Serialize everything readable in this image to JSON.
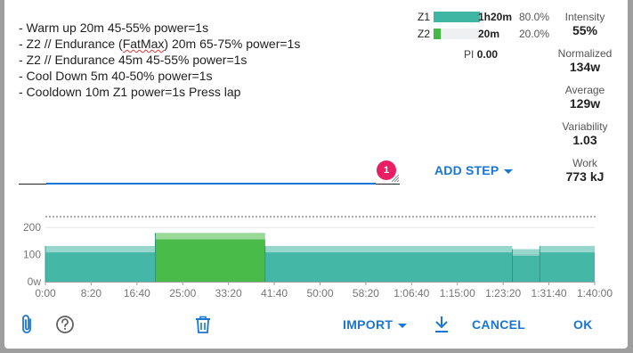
{
  "workout": {
    "lines": [
      "- Warm up 20m 45-55% power=1s",
      "- Z2 // Endurance (",
      "FatMax",
      ") 20m 65-75% power=1s",
      "- Z2 // Endurance 45m 45-55% power=1s",
      "- Cool Down 5m 40-50% power=1s",
      "- Cooldown 10m Z1 power=1s Press lap"
    ],
    "notification_count": "1"
  },
  "zones": [
    {
      "label": "Z1",
      "time": "1h20m",
      "percent": "80.0%",
      "fraction": 1.0,
      "color": "#3fb5a3"
    },
    {
      "label": "Z2",
      "time": "20m",
      "percent": "20.0%",
      "fraction": 0.0,
      "color": "#43b943"
    }
  ],
  "pi": {
    "label": "PI",
    "value": "0.00"
  },
  "stats": [
    {
      "label": "Intensity",
      "value": "55%"
    },
    {
      "label": "Normalized",
      "value": "134w"
    },
    {
      "label": "Average",
      "value": "129w"
    },
    {
      "label": "Variability",
      "value": "1.03"
    },
    {
      "label": "Work",
      "value": "773 kJ"
    }
  ],
  "add_step": {
    "label": "ADD STEP"
  },
  "chart_data": {
    "type": "area",
    "y_ticks": [
      "200",
      "100",
      "0w"
    ],
    "ylim": [
      0,
      250
    ],
    "x_ticks": [
      "0:00",
      "8:20",
      "16:40",
      "25:00",
      "33:20",
      "41:40",
      "50:00",
      "58:20",
      "1:06:40",
      "1:15:00",
      "1:23:20",
      "1:31:40",
      "1:40:00"
    ],
    "xlim_seconds": [
      0,
      6000
    ],
    "ftp_line": 240,
    "segments": [
      {
        "start": 0,
        "end": 1200,
        "low": 108,
        "high": 132,
        "zone": "Z1"
      },
      {
        "start": 1200,
        "end": 2400,
        "low": 156,
        "high": 180,
        "zone": "Z2"
      },
      {
        "start": 2400,
        "end": 5100,
        "low": 108,
        "high": 132,
        "zone": "Z1"
      },
      {
        "start": 5100,
        "end": 5400,
        "low": 96,
        "high": 120,
        "zone": "Z1"
      },
      {
        "start": 5400,
        "end": 6000,
        "low": 108,
        "high": 132,
        "zone": "Z1"
      }
    ],
    "colors": {
      "Z1": "#3fb5a3",
      "Z2": "#43b943"
    }
  },
  "footer": {
    "import_label": "IMPORT",
    "cancel_label": "CANCEL",
    "ok_label": "OK"
  }
}
